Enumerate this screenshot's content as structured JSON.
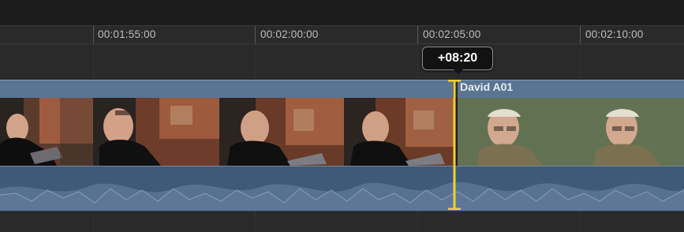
{
  "ruler": {
    "timecodes": [
      "00:01:55:00",
      "00:02:00:00",
      "00:02:05:00",
      "00:02:10:00"
    ]
  },
  "trim": {
    "offset_label": "+08:20"
  },
  "clips": {
    "right_clip_name": "David A01"
  },
  "colors": {
    "selection": "#f3d02b",
    "clip_blue": "#5a7592",
    "audio_blue": "#3f5a76"
  }
}
